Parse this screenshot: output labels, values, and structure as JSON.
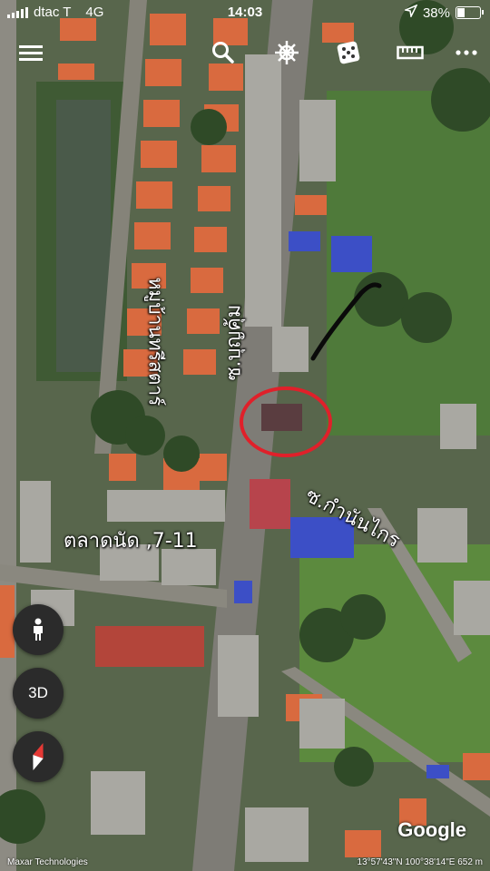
{
  "status": {
    "carrier": "dtac T",
    "network": "4G",
    "time": "14:03",
    "battery_text": "38%",
    "battery_level": 0.38
  },
  "toolbar": {
    "icons": [
      "menu-icon",
      "search-icon",
      "ship-wheel-icon",
      "dice-icon",
      "ruler-icon",
      "more-icon"
    ]
  },
  "labels": {
    "road_main": "ซ.บุญคุ้ม",
    "village": "หมู่บ้านทรีสตาร์",
    "market": "ตลาดนัด ,7-11",
    "side_road": "ซ.กำนันไกร"
  },
  "controls": {
    "pegman_icon": "person-icon",
    "three_d_label": "3D",
    "compass_icon": "compass-icon"
  },
  "footer": {
    "attribution": "Maxar Technologies",
    "coordinates": "13°57'43\"N 100°38'14\"E",
    "altitude": "652 m",
    "logo": "Google"
  },
  "colors": {
    "annotation_circle": "#e0202a",
    "annotation_line": "#0a0a0a",
    "fab_bg": "#2b2b2b"
  }
}
